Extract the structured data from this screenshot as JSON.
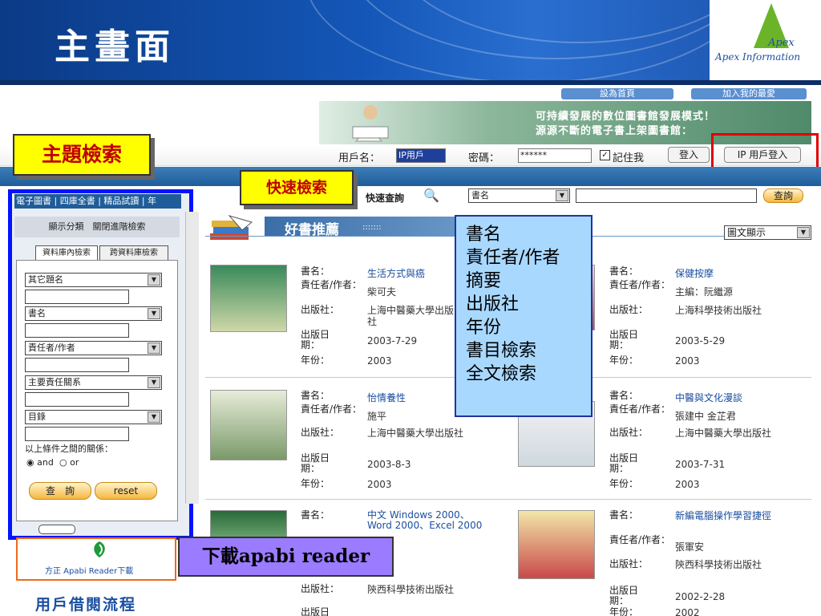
{
  "slide": {
    "title": "主畫面",
    "logo_word": "Apex",
    "logo_sub": "Apex Information",
    "accent": "#0014ff",
    "callout_bg": "#ffff00",
    "popup_bg": "#a9d8ff"
  },
  "site": {
    "top_links": [
      "設為首頁",
      "加入我的最愛"
    ],
    "banner": [
      "可持續發展的數位圖書館發展模式！",
      "源源不斷的電子書上架圖書館："
    ],
    "login": {
      "user_label": "用戶名：",
      "user_value": "IP用戶",
      "pwd_label": "密碼：",
      "pwd_value": "******",
      "remember_label": "記住我",
      "login_button": "登入",
      "ip_login_button": "IP 用戶登入"
    },
    "left_tabs": "電子圖書 | 四庫全書 | 精品試讀 | 年",
    "classify": "顯示分類　關閉進階檢索",
    "sub_tabs": [
      "資料庫內檢索",
      "跨資料庫檢索"
    ],
    "fields": [
      "其它題名",
      "書名",
      "責任者/作者",
      "主要責任關系",
      "目錄"
    ],
    "relation_label": "以上條件之間的關係：",
    "radio": [
      "and",
      "or"
    ],
    "search_button": "查　詢",
    "reset_button": "reset",
    "apabi_label": "方正 Apabi Reader下載",
    "borrow_flow": "用戶借閱流程",
    "quick": {
      "label": "快速查詢",
      "select_value": "書名",
      "button": "查詢"
    },
    "rec_title": "好書推薦",
    "rec_dots": ":::::::",
    "view_mode": "圖文顯示",
    "field_labels": {
      "title": "書名：",
      "author": "責任者/作者：",
      "publisher": "出版社：",
      "pubdate": "出版日期：",
      "year": "年份："
    },
    "books": [
      {
        "title": "生活方式與癌",
        "author": "柴可夫",
        "publisher": "上海中醫藥大學出版社",
        "pubdate": "2003-7-29",
        "year": "2003"
      },
      {
        "title": "保健按摩",
        "author": "主編：阮繼源",
        "publisher": "上海科學技術出版社",
        "pubdate": "2003-5-29",
        "year": "2003"
      },
      {
        "title": "怡情養性",
        "author": "施平",
        "publisher": "上海中醫藥大學出版社",
        "pubdate": "2003-8-3",
        "year": "2003"
      },
      {
        "title": "中醫與文化漫談",
        "author": "張建中 金芷君",
        "publisher": "上海中醫藥大學出版社",
        "pubdate": "2003-7-31",
        "year": "2003"
      },
      {
        "title": "中文 Windows 2000、Word 2000、Excel 2000",
        "author": "",
        "publisher": "陝西科學技術出版社",
        "pubdate": "",
        "year": ""
      },
      {
        "title": "新編電腦操作學習捷徑",
        "author": "張軍安",
        "publisher": "陝西科學技術出版社",
        "pubdate": "2002-2-28",
        "year": "2002"
      }
    ]
  },
  "overlays": {
    "topic_search": "主題檢索",
    "quick_search": "快速檢索",
    "popup_items": [
      "書名",
      "責任者/作者",
      "摘要",
      "出版社",
      "年份",
      "書目檢索",
      "全文檢索"
    ],
    "apabi_download": "下載apabi reader"
  }
}
